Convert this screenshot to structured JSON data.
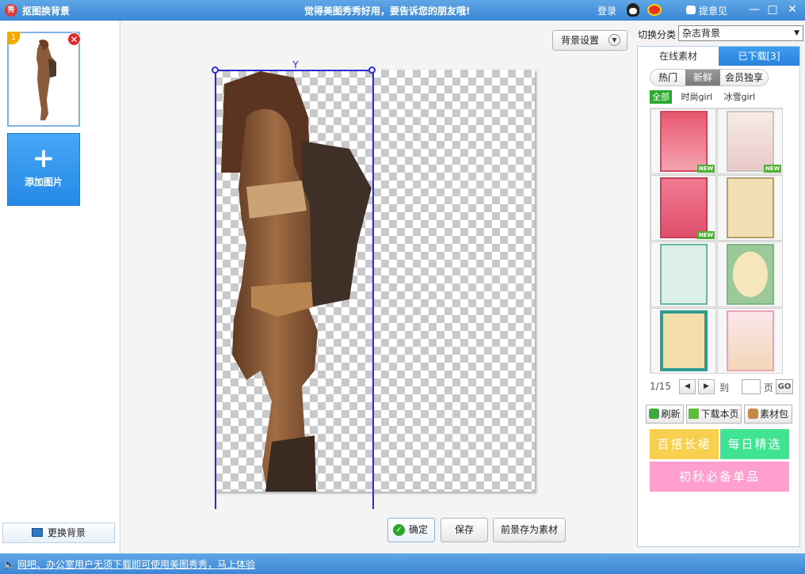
{
  "titlebar": {
    "app_icon": "秀",
    "title": "抠图换背景",
    "slogan": "觉得美图秀秀好用，要告诉您的朋友哦!",
    "login": "登录",
    "feedback": "提意见",
    "minimize": "—",
    "maximize": "□",
    "close": "✕",
    "icons": [
      "qq-icon",
      "weibo-icon",
      "feedback-icon"
    ]
  },
  "left": {
    "thumb_number": "1",
    "thumb_close": "✕",
    "add_plus": "+",
    "add_label": "添加图片",
    "change_bg": "更换背景"
  },
  "canvas": {
    "bg_settings": "背景设置",
    "chevron": "▼",
    "rotate_handle": "Y",
    "confirm": "确定",
    "save": "保存",
    "save_fg": "前景存为素材"
  },
  "right": {
    "category_label": "切换分类",
    "category_value": "杂志背景",
    "select_arrow": "▼",
    "tabs": {
      "online": "在线素材",
      "downloaded": "已下载[3]"
    },
    "subtabs": [
      "热门",
      "新鲜",
      "会员独享"
    ],
    "filters": [
      "全部",
      "时尚girl",
      "冰雪girl"
    ],
    "new_badge": "NEW",
    "pager": {
      "current": "1/15",
      "prev": "◀",
      "next": "▶",
      "to": "到",
      "page": "页",
      "go": "GO"
    },
    "actions": {
      "refresh": "刷新",
      "download_page": "下载本页",
      "material_pack": "素材包"
    },
    "promos": [
      "百搭长裙",
      "每日精选",
      "初秋必备单品"
    ]
  },
  "colors": {
    "accent": "#3d8ad8",
    "selection": "#2b2bd6",
    "promo_yellow": "#f9cf4f",
    "promo_green": "#3fe391",
    "promo_pink": "#ff9fcf"
  },
  "status": {
    "speaker": "🔈",
    "text": "网吧、办公室用户无须下载即可使用美图秀秀，马上体验"
  }
}
